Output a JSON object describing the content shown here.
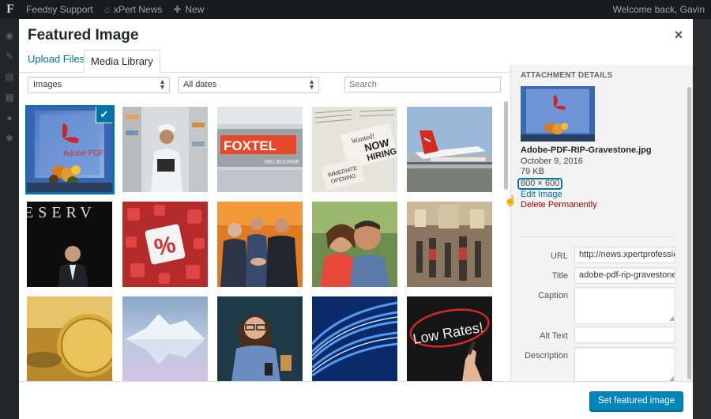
{
  "adminbar": {
    "site_name": "Feedsy Support",
    "site2": "xPert News",
    "new_label": "New",
    "greeting": "Welcome back, Gavin"
  },
  "modal": {
    "title": "Featured Image",
    "close_symbol": "×",
    "tabs": [
      {
        "label": "Upload Files",
        "active": false
      },
      {
        "label": "Media Library",
        "active": true
      }
    ]
  },
  "filters": {
    "type_selected": "Images",
    "date_selected": "All dates",
    "search_placeholder": "Search"
  },
  "grid": {
    "items": [
      {
        "subject": "Adobe PDF gravestone with flowers",
        "selected": true
      },
      {
        "subject": "Warehouse worker with clipboard",
        "selected": false
      },
      {
        "subject": "Foxtel Melbourne sign",
        "selected": false
      },
      {
        "subject": "Newspapers",
        "selected": false
      },
      {
        "subject": "Qantas aircraft",
        "selected": false
      },
      {
        "subject": "Reserve bank man",
        "selected": false
      },
      {
        "subject": "Percent symbol cubes",
        "selected": false
      },
      {
        "subject": "Business people shaking hands",
        "selected": false
      },
      {
        "subject": "Smiling couple",
        "selected": false
      },
      {
        "subject": "Shopping mall crowd",
        "selected": false
      },
      {
        "subject": "Gold coin",
        "selected": false
      },
      {
        "subject": "Iceberg reflection",
        "selected": false
      },
      {
        "subject": "Woman with phone and coffee",
        "selected": false
      },
      {
        "subject": "Network cables",
        "selected": false
      },
      {
        "subject": "Low Rates handwriting",
        "selected": false
      }
    ]
  },
  "sidebar": {
    "heading": "Attachment Details",
    "filename": "Adobe-PDF-RIP-Gravestone.jpg",
    "date": "October 9, 2016",
    "filesize": "79 KB",
    "dimensions": "800 × 600",
    "edit_link": "Edit Image",
    "delete_link": "Delete Permanently",
    "fields": {
      "url_label": "URL",
      "url_value": "http://news.xpertprofessic",
      "title_label": "Title",
      "title_value": "adobe-pdf-rip-gravestone",
      "caption_label": "Caption",
      "alt_label": "Alt Text",
      "description_label": "Description"
    }
  },
  "thumb_texts": {
    "adobe": "Adobe PDF",
    "foxtel": "FOXTEL",
    "foxtel_sub": "MELBOURNE",
    "news1": "Wanted!",
    "news2": "NOW",
    "news3": "HIRING",
    "news4": "IMMEDIATE",
    "news5": "OPENING",
    "reserve": "ESERV",
    "percent": "%",
    "lowrates": "Low Rates!"
  },
  "footer": {
    "primary_label": "Set featured image"
  },
  "colors": {
    "accent": "#0073aa",
    "primary_button": "#0085ba",
    "delete": "#aa0000"
  }
}
